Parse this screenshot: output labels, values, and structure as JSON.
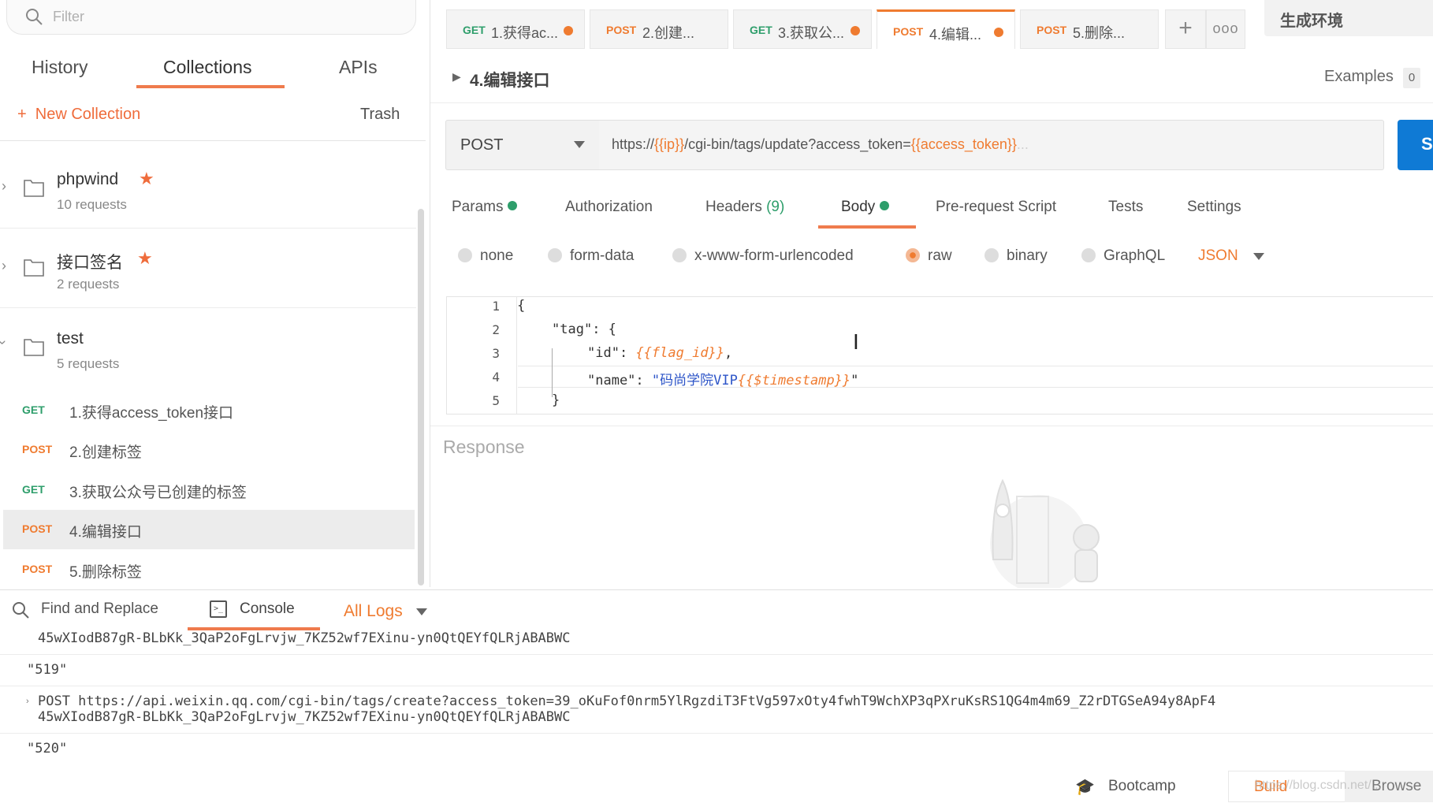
{
  "sidebar": {
    "filter_placeholder": "Filter",
    "tabs": [
      "History",
      "Collections",
      "APIs"
    ],
    "active_tab": "Collections",
    "new_collection": "New Collection",
    "trash": "Trash",
    "collections": [
      {
        "name": "phpwind",
        "count": "10 requests",
        "starred": true,
        "expanded": false
      },
      {
        "name": "接口签名",
        "count": "2 requests",
        "starred": true,
        "expanded": false
      },
      {
        "name": "test",
        "count": "5 requests",
        "starred": false,
        "expanded": true
      }
    ],
    "requests": [
      {
        "method": "GET",
        "name": "1.获得access_token接口"
      },
      {
        "method": "POST",
        "name": "2.创建标签"
      },
      {
        "method": "GET",
        "name": "3.获取公众号已创建的标签"
      },
      {
        "method": "POST",
        "name": "4.编辑接口",
        "active": true
      },
      {
        "method": "POST",
        "name": "5.删除标签"
      }
    ]
  },
  "tabs": [
    {
      "method": "GET",
      "label": "1.获得ac...",
      "dot": true
    },
    {
      "method": "POST",
      "label": "2.创建...",
      "dot": false
    },
    {
      "method": "GET",
      "label": "3.获取公...",
      "dot": true
    },
    {
      "method": "POST",
      "label": "4.编辑...",
      "dot": true,
      "active": true
    },
    {
      "method": "POST",
      "label": "5.删除...",
      "dot": false
    }
  ],
  "environment": "生成环境",
  "request": {
    "name": "4.编辑接口",
    "examples_label": "Examples",
    "examples_count": "0",
    "method": "POST",
    "url_prefix": "https://",
    "url_var_ip": "{{ip}}",
    "url_path": "/cgi-bin/tags/update?access_token=",
    "url_var_token": "{{access_token}}",
    "url_trail": "...",
    "send_label": "S"
  },
  "param_tabs": {
    "params": "Params",
    "authorization": "Authorization",
    "headers": "Headers",
    "headers_count": "(9)",
    "body": "Body",
    "prerequest": "Pre-request Script",
    "tests": "Tests",
    "settings": "Settings"
  },
  "body_types": {
    "none": "none",
    "form_data": "form-data",
    "urlencoded": "x-www-form-urlencoded",
    "raw": "raw",
    "binary": "binary",
    "graphql": "GraphQL",
    "format": "JSON"
  },
  "code": {
    "line_numbers": [
      "1",
      "2",
      "3",
      "4",
      "5"
    ],
    "l1": "{",
    "l2_key": "\"tag\"",
    "l2_rest": ": {",
    "l3_key": "\"id\"",
    "l3_colon": ": ",
    "l3_val": "{{flag_id}}",
    "l3_comma": ",",
    "l4_key": "\"name\"",
    "l4_colon": ": ",
    "l4_str": "\"码尚学院VIP",
    "l4_var": "{{$timestamp}}",
    "l4_end": "\"",
    "l5": "}"
  },
  "response_label": "Response",
  "console": {
    "find_replace": "Find and Replace",
    "console": "Console",
    "all_logs": "All Logs",
    "lines": [
      "45wXIodB87gR-BLbKk_3QaP2oFgLrvjw_7KZ52wf7EXinu-yn0QtQEYfQLRjABABWC",
      "\"519\"",
      "POST https://api.weixin.qq.com/cgi-bin/tags/create?access_token=39_oKuFof0nrm5YlRgzdiT3FtVg597xOty4fwhT9WchXP3qPXruKsRS1QG4m4m69_Z2rDTGSeA94y8ApF4",
      "45wXIodB87gR-BLbKk_3QaP2oFgLrvjw_7KZ52wf7EXinu-yn0QtQEYfQLRjABABWC",
      "\"520\""
    ]
  },
  "footer": {
    "bootcamp": "Bootcamp",
    "build": "Build",
    "browse": "Browse",
    "watermark": "https://blog.csdn.net/..."
  },
  "colors": {
    "accent": "#ef7b30",
    "get": "#2e9e6b",
    "send": "#0f7ad5"
  }
}
